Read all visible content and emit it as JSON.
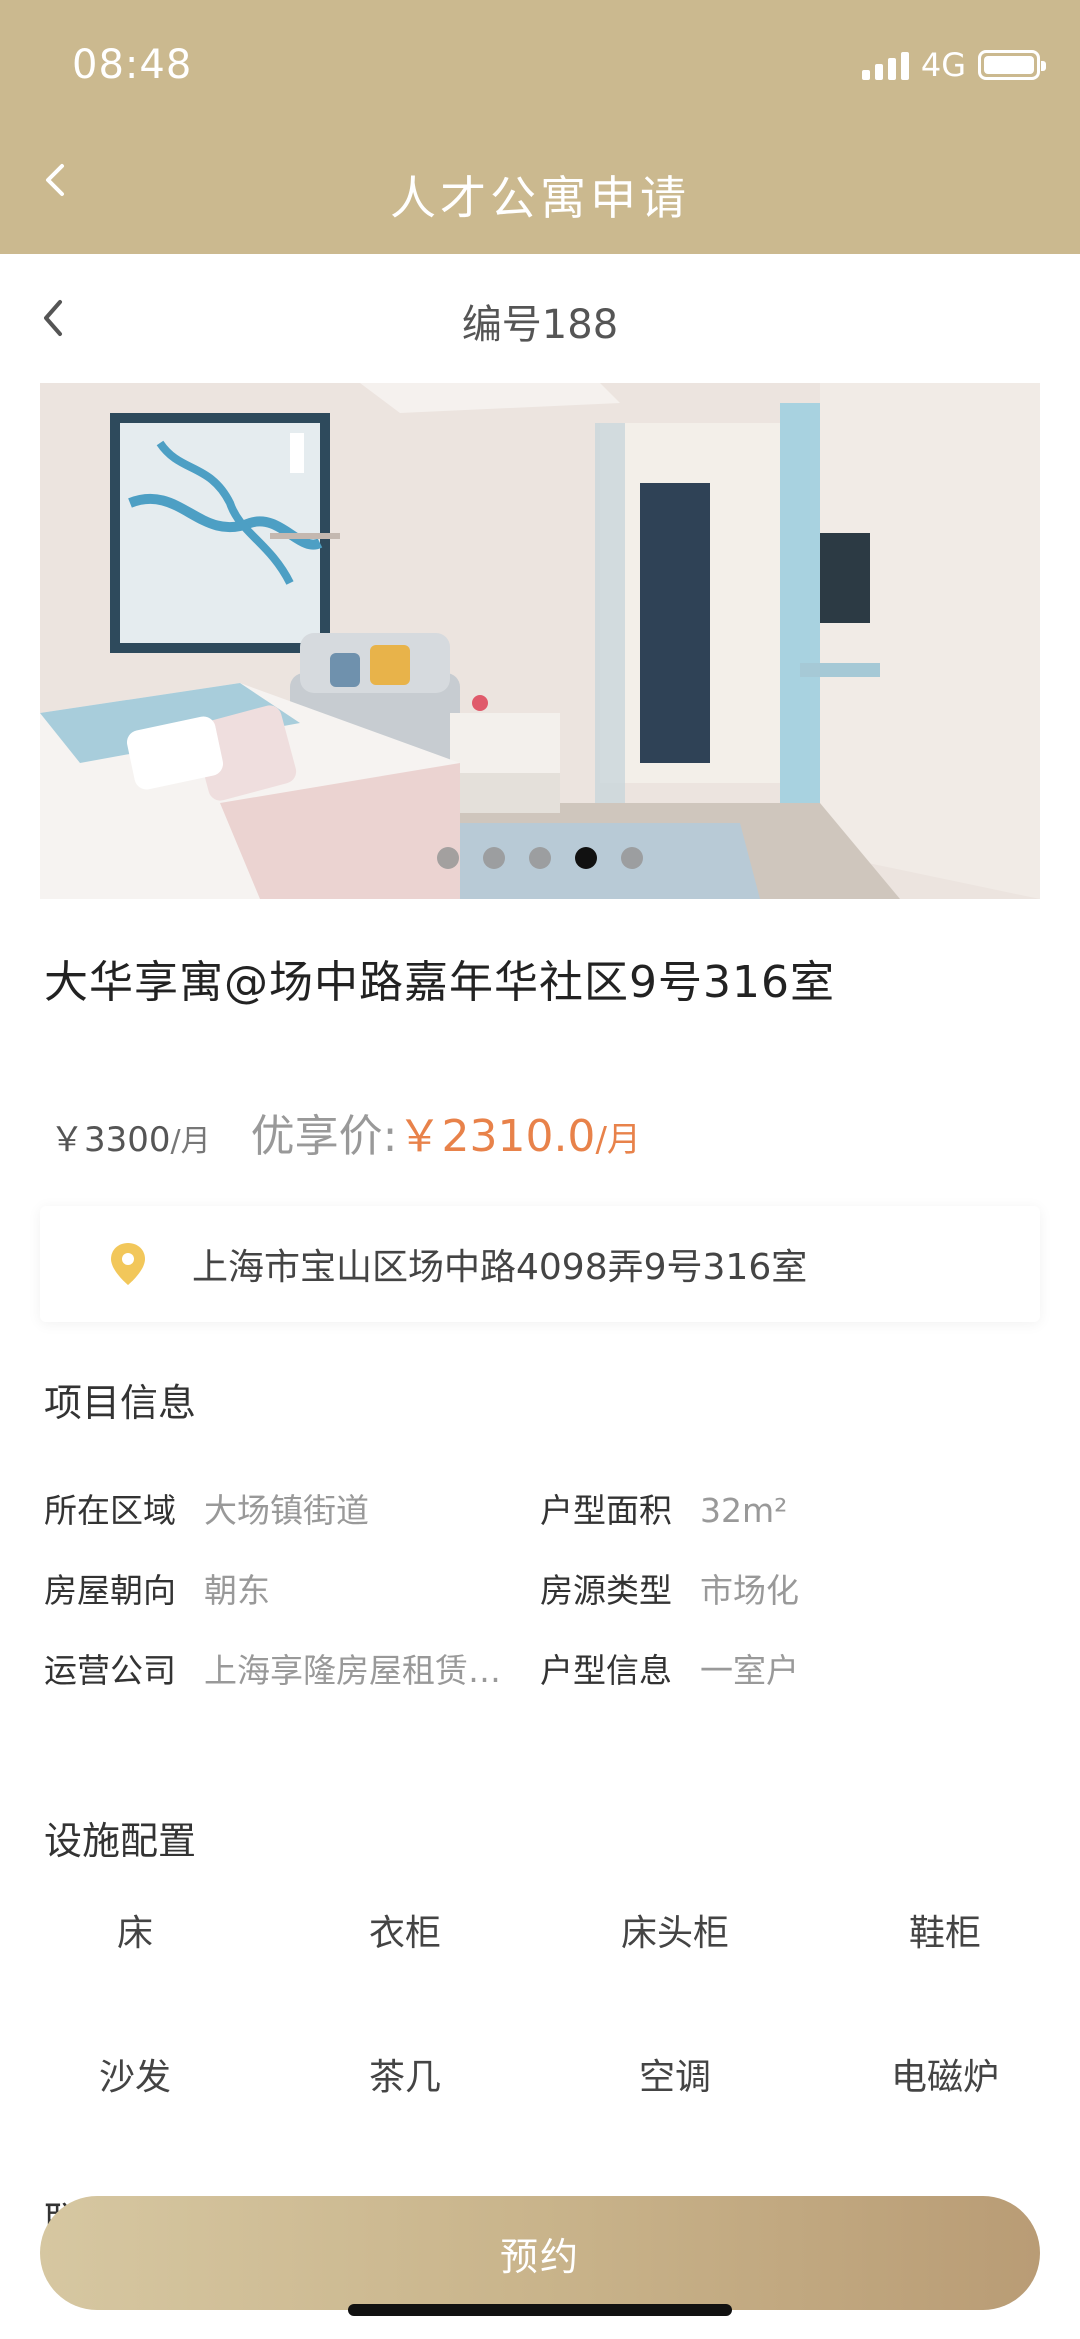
{
  "status": {
    "time": "08:48",
    "network": "4G"
  },
  "header": {
    "title": "人才公寓申请"
  },
  "subheader": {
    "title": "编号188"
  },
  "gallery": {
    "count": 5,
    "active_index": 3
  },
  "listing": {
    "title": "大华享寓@场中路嘉年华社区9号316室",
    "original_price": "￥3300",
    "original_unit": "/月",
    "deal_label": "优享价:",
    "deal_price": "￥2310.0",
    "deal_unit": "/月",
    "address": "上海市宝山区场中路4098弄9号316室"
  },
  "project_info": {
    "title": "项目信息",
    "rows": [
      {
        "l1": "所在区域",
        "v1": "大场镇街道",
        "l2": "户型面积",
        "v2": "32m²"
      },
      {
        "l1": "房屋朝向",
        "v1": "朝东",
        "l2": "房源类型",
        "v2": "市场化"
      },
      {
        "l1": "运营公司",
        "v1": "上海享隆房屋租赁…",
        "l2": "户型信息",
        "v2": "一室户"
      }
    ]
  },
  "facilities": {
    "title": "设施配置",
    "items": [
      "床",
      "衣柜",
      "床头柜",
      "鞋柜",
      "沙发",
      "茶几",
      "空调",
      "电磁炉"
    ]
  },
  "next_section_partial": "联",
  "cta": {
    "label": "预约"
  },
  "colors": {
    "header_bg": "#cbb98f",
    "accent_price": "#e8824a",
    "cta_start": "#d6c7a1",
    "cta_end": "#b99c75"
  }
}
